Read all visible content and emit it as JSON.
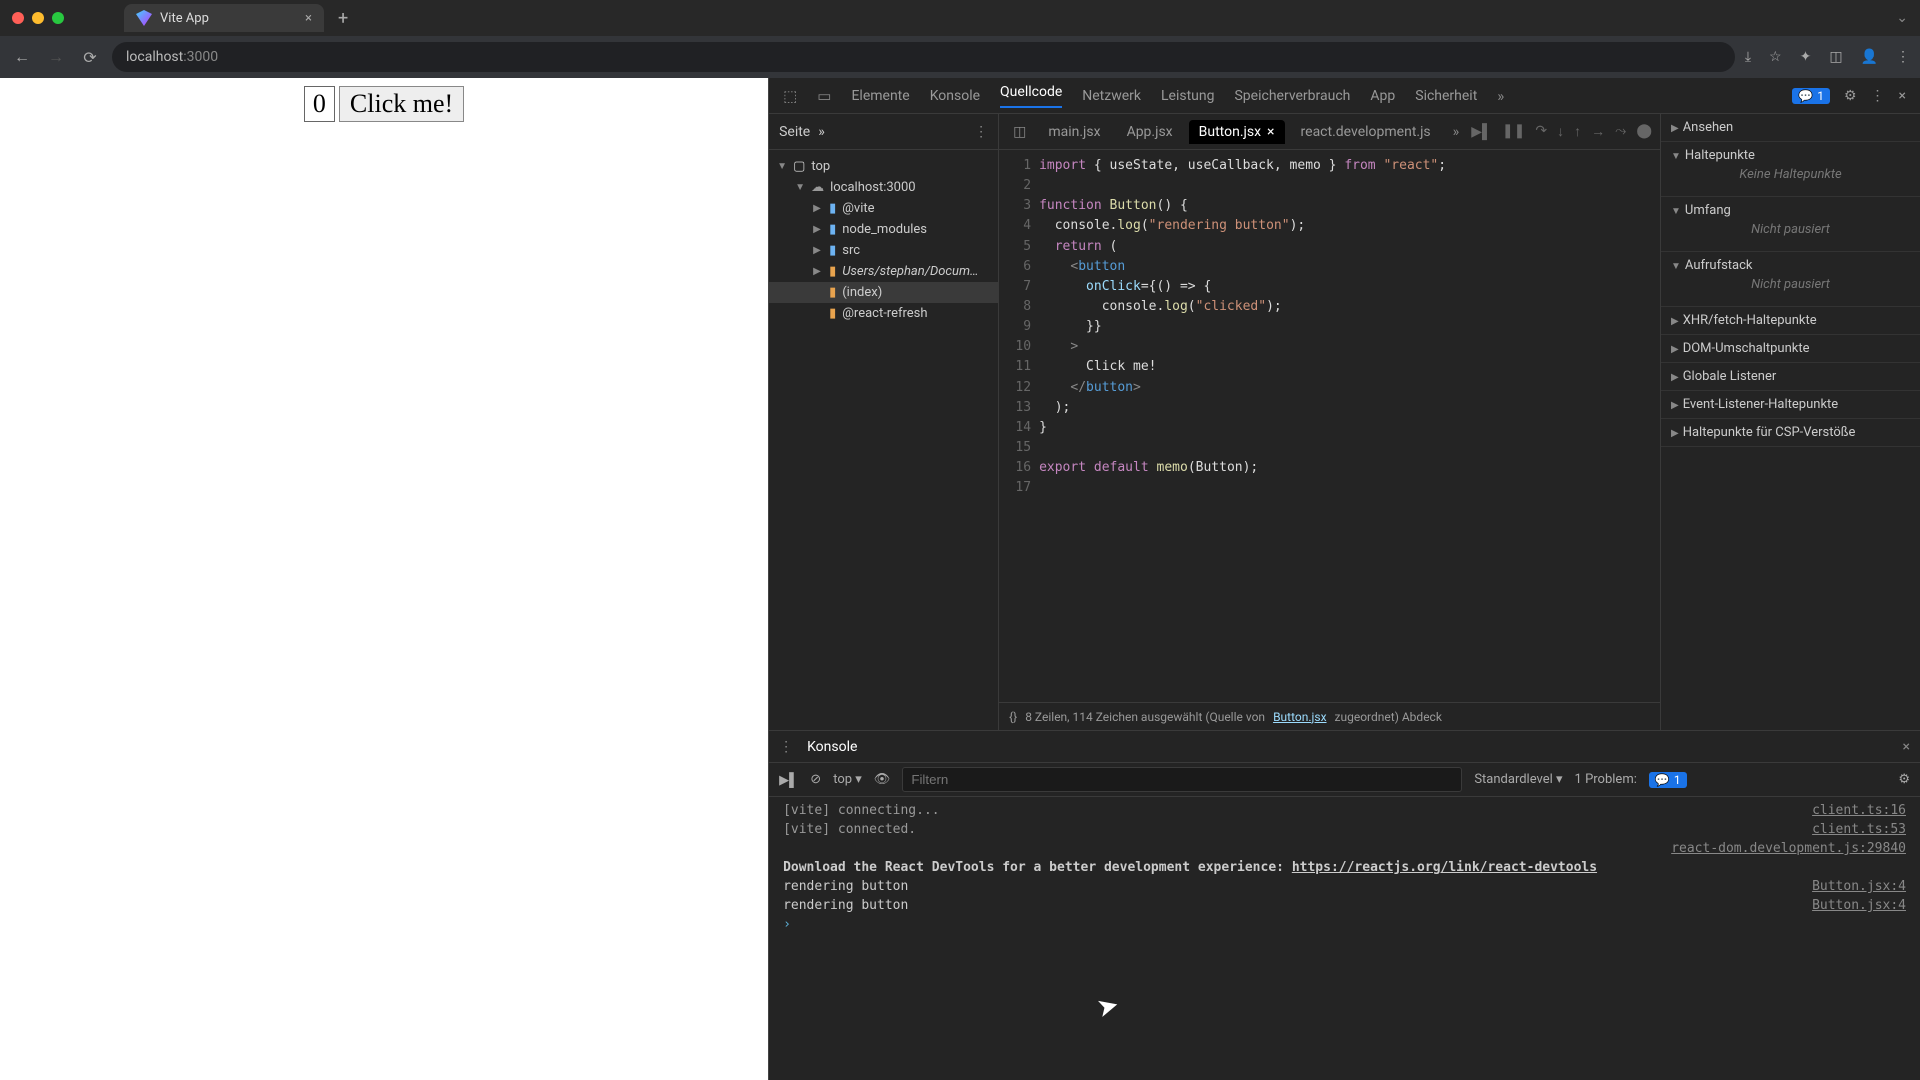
{
  "browser": {
    "tab_title": "Vite App",
    "url_host": "localhost",
    "url_port": ":3000"
  },
  "page": {
    "counter": "0",
    "button_label": "Click me!"
  },
  "devtools": {
    "tabs": {
      "elements": "Elemente",
      "console": "Konsole",
      "sources": "Quellcode",
      "network": "Netzwerk",
      "performance": "Leistung",
      "memory": "Speicherverbrauch",
      "application": "App",
      "security": "Sicherheit"
    },
    "issues_count": "1",
    "sidebar_title": "Seite",
    "file_tree": {
      "top": "top",
      "host": "localhost:3000",
      "vite": "@vite",
      "node_modules": "node_modules",
      "src": "src",
      "users_path": "Users/stephan/Docum…",
      "index": "(index)",
      "react_refresh": "@react-refresh"
    },
    "editor_tabs": {
      "main": "main.jsx",
      "app": "App.jsx",
      "button": "Button.jsx",
      "react_dev": "react.development.js"
    },
    "code_lines": {
      "l1a": "import",
      "l1b": " { useState, useCallback, memo } ",
      "l1c": "from",
      "l1d": " \"react\"",
      "l1e": ";",
      "l3a": "function",
      "l3b": " Button",
      "l3c": "() {",
      "l4a": "  console.",
      "l4b": "log",
      "l4c": "(",
      "l4d": "\"rendering button\"",
      "l4e": ");",
      "l5a": "  ",
      "l5b": "return",
      "l5c": " (",
      "l6a": "    <",
      "l6b": "button",
      "l7a": "      onClick",
      "l7b": "={() => {",
      "l8a": "        console.",
      "l8b": "log",
      "l8c": "(",
      "l8d": "\"clicked\"",
      "l8e": ");",
      "l9": "      }}",
      "l10": "    >",
      "l11": "      Click me!",
      "l12a": "    </",
      "l12b": "button",
      "l12c": ">",
      "l13": "  );",
      "l14": "}",
      "l16a": "export",
      "l16b": " default",
      "l16c": " memo",
      "l16d": "(Button);"
    },
    "statusline": {
      "text_a": "8 Zeilen, 114 Zeichen ausgewählt  (Quelle von ",
      "link": "Button.jsx",
      "text_b": " zugeordnet)  Abdeck"
    },
    "debugger": {
      "watch": "Ansehen",
      "breakpoints": "Haltepunkte",
      "breakpoints_empty": "Keine Haltepunkte",
      "scope": "Umfang",
      "scope_empty": "Nicht pausiert",
      "callstack": "Aufrufstack",
      "callstack_empty": "Nicht pausiert",
      "xhr": "XHR/fetch-Haltepunkte",
      "dom": "DOM-Umschaltpunkte",
      "global": "Globale Listener",
      "event": "Event-Listener-Haltepunkte",
      "csp": "Haltepunkte für CSP-Verstöße"
    }
  },
  "drawer": {
    "tab": "Konsole",
    "context": "top",
    "filter_placeholder": "Filtern",
    "level": "Standardlevel",
    "problems_label": "1 Problem:",
    "problems_count": "1",
    "logs": [
      {
        "msg": "[vite] connecting...",
        "src": "client.ts:16"
      },
      {
        "msg": "[vite] connected.",
        "src": "client.ts:53"
      },
      {
        "msg": "",
        "src": "react-dom.development.js:29840"
      },
      {
        "msg": "Download the React DevTools for a better development experience: ",
        "link": "https://reactjs.org/link/react-devtools",
        "src": ""
      },
      {
        "msg": "rendering button",
        "src": "Button.jsx:4"
      },
      {
        "msg": "rendering button",
        "src": "Button.jsx:4"
      }
    ]
  }
}
